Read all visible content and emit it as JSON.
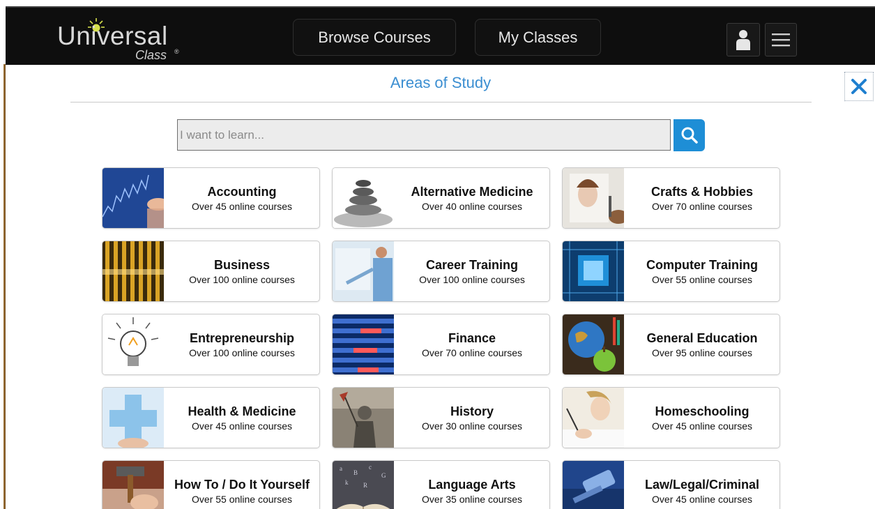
{
  "header": {
    "logo_text": "Universal",
    "logo_sub": "Class",
    "logo_reg": "®",
    "nav": [
      {
        "label": "Browse Courses"
      },
      {
        "label": "My Classes"
      }
    ]
  },
  "panel": {
    "title": "Areas of Study",
    "close_symbol": "✕"
  },
  "search": {
    "placeholder": "I want to learn...",
    "value": ""
  },
  "colors": {
    "accent": "#3b8ed1",
    "search_button": "#1e8ed6",
    "header_bg": "#0e0e0e"
  },
  "categories": [
    {
      "title": "Accounting",
      "subtitle": "Over 45 online courses",
      "icon": "accounting-thumbnail"
    },
    {
      "title": "Alternative Medicine",
      "subtitle": "Over 40 online courses",
      "icon": "stacked-stones-thumbnail"
    },
    {
      "title": "Crafts & Hobbies",
      "subtitle": "Over 70 online courses",
      "icon": "painting-thumbnail"
    },
    {
      "title": "Business",
      "subtitle": "Over 100 online courses",
      "icon": "skyscraper-thumbnail"
    },
    {
      "title": "Career Training",
      "subtitle": "Over 100 online courses",
      "icon": "presenter-thumbnail"
    },
    {
      "title": "Computer Training",
      "subtitle": "Over 55 online courses",
      "icon": "circuit-chip-thumbnail"
    },
    {
      "title": "Entrepreneurship",
      "subtitle": "Over 100 online courses",
      "icon": "lightbulb-thumbnail"
    },
    {
      "title": "Finance",
      "subtitle": "Over 70 online courses",
      "icon": "stock-ticker-thumbnail"
    },
    {
      "title": "General Education",
      "subtitle": "Over 95 online courses",
      "icon": "globe-apple-thumbnail"
    },
    {
      "title": "Health & Medicine",
      "subtitle": "Over 45 online courses",
      "icon": "medical-cross-thumbnail"
    },
    {
      "title": "History",
      "subtitle": "Over 30 online courses",
      "icon": "knight-thumbnail"
    },
    {
      "title": "Homeschooling",
      "subtitle": "Over 45 online courses",
      "icon": "child-writing-thumbnail"
    },
    {
      "title": "How To / Do It Yourself",
      "subtitle": "Over 55 online courses",
      "icon": "hammer-thumbnail"
    },
    {
      "title": "Language Arts",
      "subtitle": "Over 35 online courses",
      "icon": "open-book-thumbnail"
    },
    {
      "title": "Law/Legal/Criminal",
      "subtitle": "Over 45 online courses",
      "icon": "gavel-thumbnail"
    }
  ]
}
